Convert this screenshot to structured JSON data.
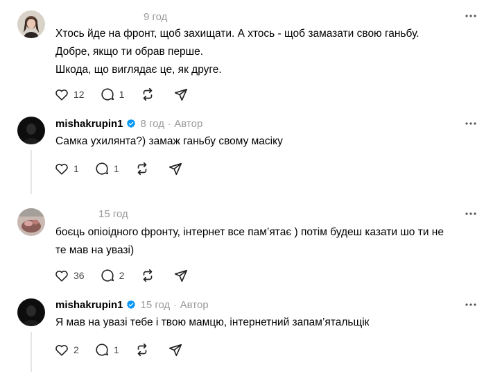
{
  "posts": [
    {
      "time": "9 год",
      "lines": [
        "Хтось йде на фронт, щоб захищати. А хтось - щоб замазати свою ганьбу.",
        "Добре, якщо ти обрав перше.",
        "Шкода, що виглядає це, як друге."
      ],
      "likes": "12",
      "replies": "1"
    },
    {
      "username": "mishakrupin1",
      "time": "8 год",
      "author_label": "Автор",
      "lines": [
        "Самка ухилянта?) замаж ганьбу свому масіку"
      ],
      "likes": "1",
      "replies": "1"
    },
    {
      "time": "15 год",
      "lines": [
        "боєць опіоідного фронту, інтернет все пам’ятає ) потім будеш казати шо ти не",
        "те мав на увазі)"
      ],
      "likes": "36",
      "replies": "2"
    },
    {
      "username": "mishakrupin1",
      "time": "15 год",
      "author_label": "Автор",
      "lines": [
        "Я мав на увазі тебе і твою мамцю, інтернетний запам’ятальщік"
      ],
      "likes": "2",
      "replies": "1"
    }
  ],
  "icons": {
    "like": "heart-icon",
    "reply": "comment-icon",
    "repost": "repost-icon",
    "share": "share-icon",
    "more": "more-icon",
    "verified": "verified-badge-icon"
  },
  "colors": {
    "muted_text": "#999999",
    "verified": "#0095f6",
    "divider": "#e5e5e5"
  }
}
